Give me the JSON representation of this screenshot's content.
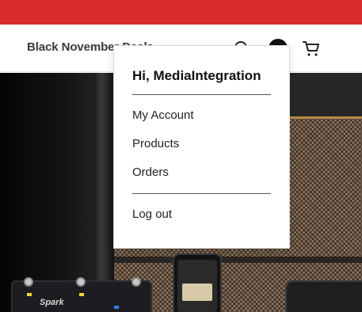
{
  "header": {
    "promo_color": "#d92b2d",
    "nav_link": "Black November Deals",
    "icons": [
      "search-icon",
      "account-avatar",
      "cart-icon"
    ]
  },
  "hero": {
    "pedal_brand": "Spark"
  },
  "account_menu": {
    "greeting": "Hi, MediaIntegration",
    "items": [
      {
        "label": "My Account"
      },
      {
        "label": "Products"
      },
      {
        "label": "Orders"
      }
    ],
    "logout_label": "Log out"
  }
}
